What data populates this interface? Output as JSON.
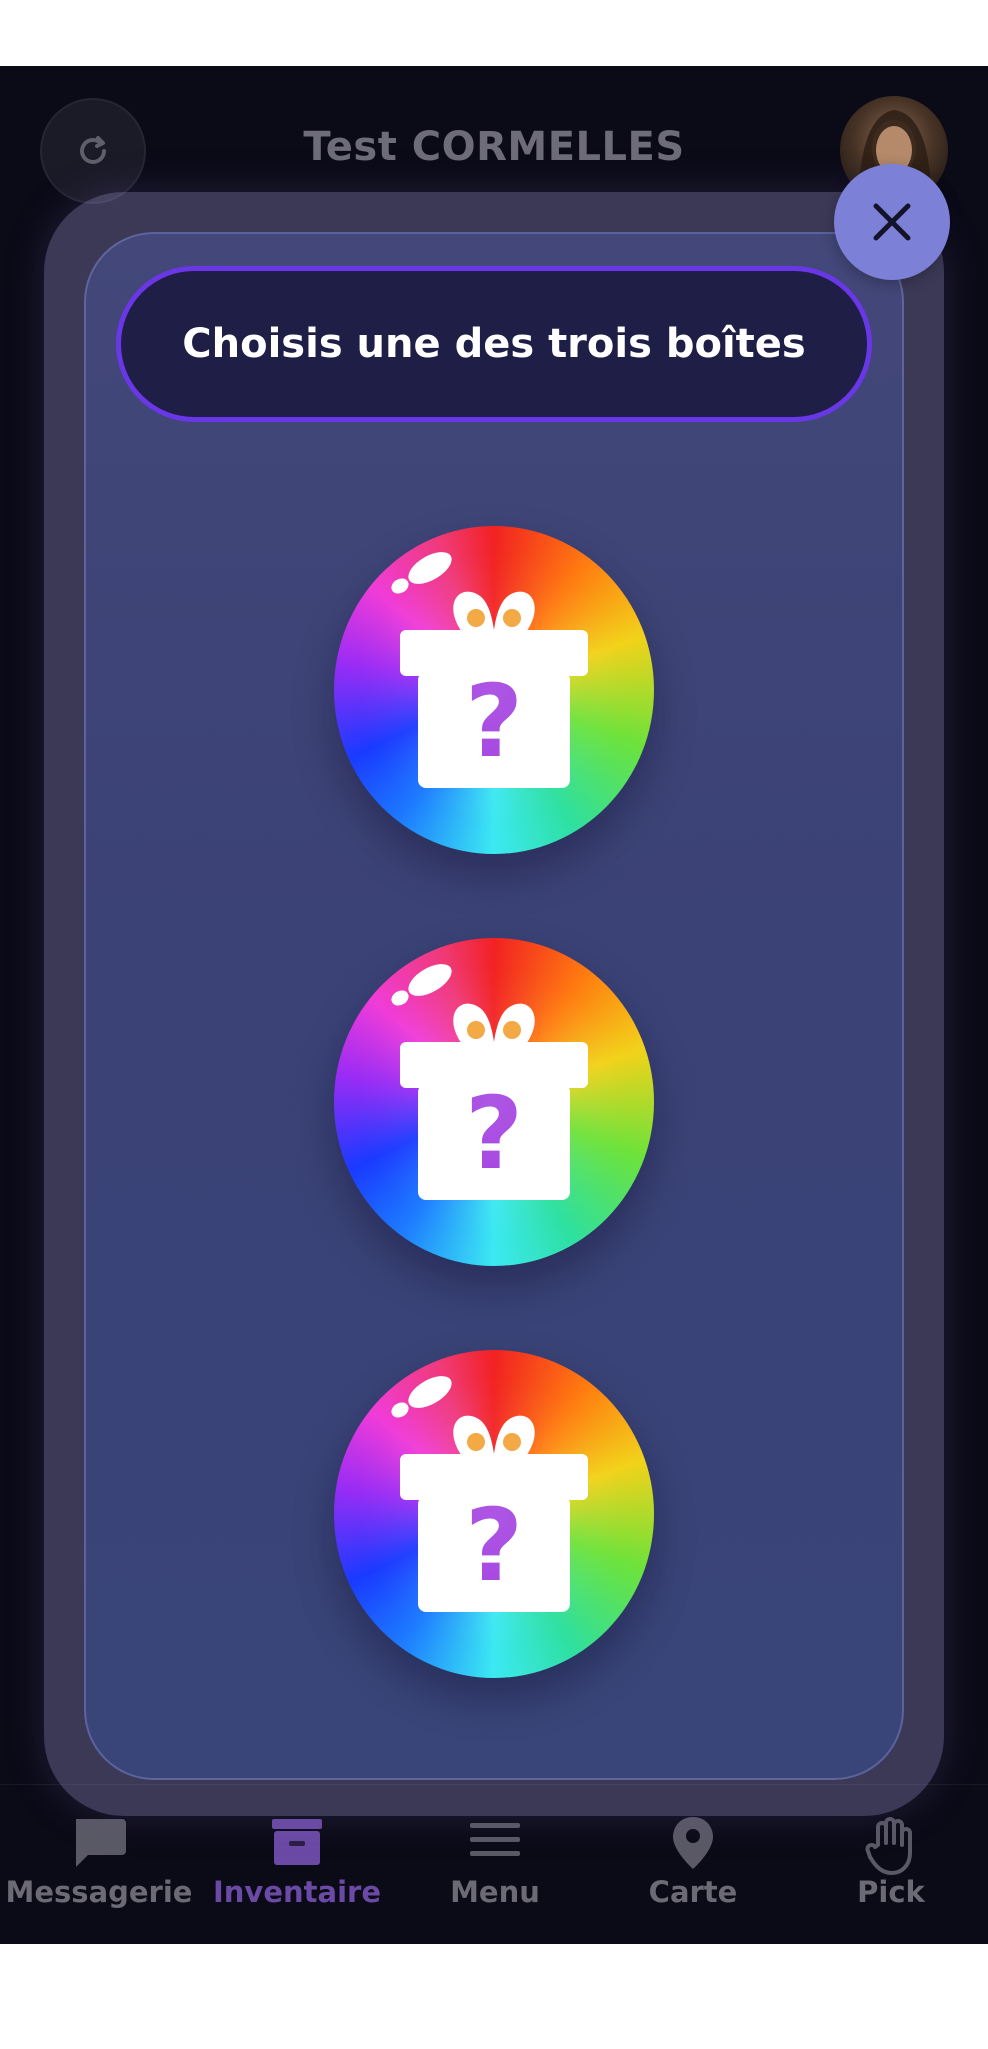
{
  "header": {
    "title": "Test CORMELLES",
    "refresh_icon": "refresh-icon",
    "avatar": "user-avatar"
  },
  "bottom_nav": {
    "active": "Inventaire",
    "items": [
      {
        "label": "Messagerie",
        "icon": "chat-bubble-icon"
      },
      {
        "label": "Inventaire",
        "icon": "inventory-box-icon"
      },
      {
        "label": "Menu",
        "icon": "hamburger-menu-icon"
      },
      {
        "label": "Carte",
        "icon": "map-pin-icon"
      },
      {
        "label": "Pick",
        "icon": "hand-icon"
      }
    ]
  },
  "modal": {
    "prompt": "Choisis une des trois boîtes",
    "close_icon": "close-icon",
    "boxes": [
      {
        "icon": "mystery-gift-icon",
        "symbol": "?"
      },
      {
        "icon": "mystery-gift-icon",
        "symbol": "?"
      },
      {
        "icon": "mystery-gift-icon",
        "symbol": "?"
      }
    ]
  },
  "colors": {
    "background": "#0b0a17",
    "modal_panel": "#3d4477",
    "banner_fill": "#1e1e47",
    "banner_border": "#6a37e6",
    "close_button": "#7c80d6",
    "nav_active": "#6b4aa6",
    "nav_inactive": "#6b6a75"
  }
}
